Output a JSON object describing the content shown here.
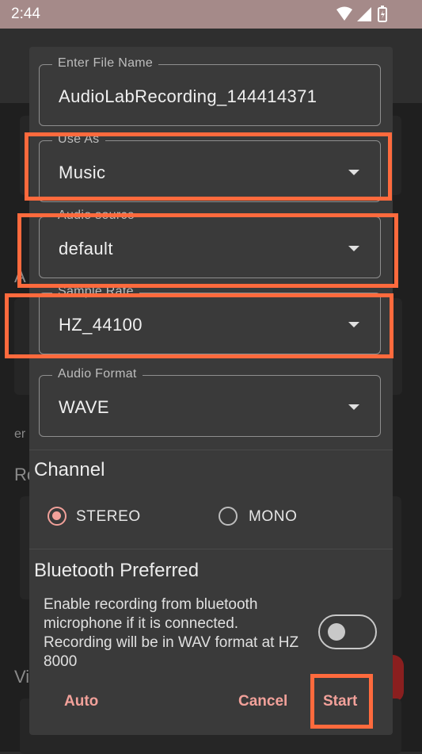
{
  "status_bar": {
    "time": "2:44"
  },
  "background": {
    "fragment_a": "A",
    "fragment_er": "er",
    "fragment_rc": "Rc",
    "fragment_vi": "Vi"
  },
  "dialog": {
    "file_name": {
      "label": "Enter File Name",
      "value": "AudioLabRecording_144414371"
    },
    "use_as": {
      "label": "Use As",
      "value": "Music"
    },
    "audio_source": {
      "label": "Audio source",
      "value": "default"
    },
    "sample_rate": {
      "label": "Sample Rate",
      "value": "HZ_44100"
    },
    "audio_format": {
      "label": "Audio Format",
      "value": "WAVE"
    },
    "channel": {
      "title": "Channel",
      "options": [
        {
          "label": "STEREO",
          "selected": true
        },
        {
          "label": "MONO",
          "selected": false
        }
      ]
    },
    "bluetooth": {
      "title": "Bluetooth Preferred",
      "description": "Enable recording from bluetooth microphone if it is connected. Recording will be in WAV format at HZ 8000",
      "enabled": false
    },
    "buttons": {
      "auto": "Auto",
      "cancel": "Cancel",
      "start": "Start"
    }
  },
  "colors": {
    "accent": "#f2a19a",
    "highlight": "#ff6a3d",
    "status_bar": "#a58a89"
  }
}
